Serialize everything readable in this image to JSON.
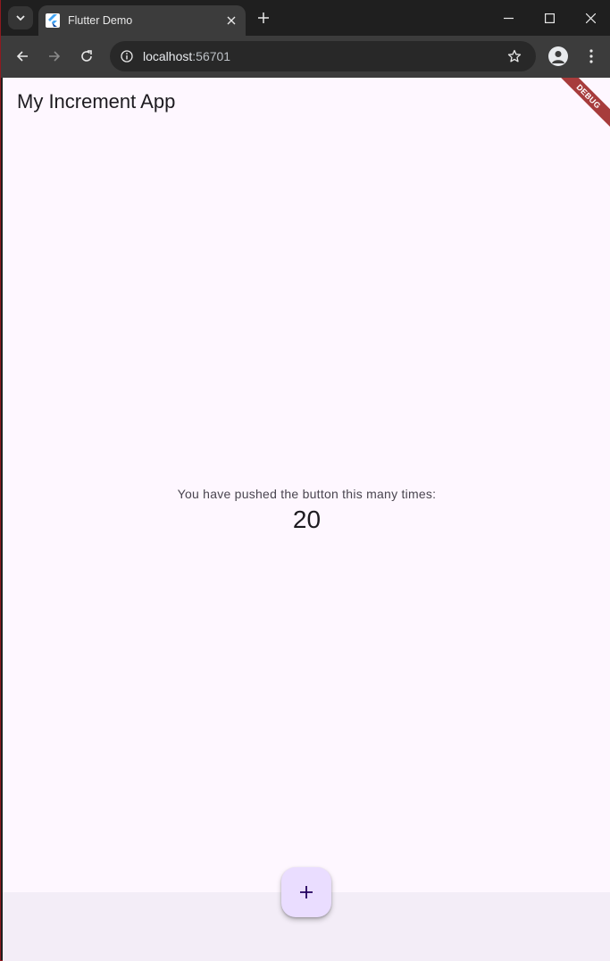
{
  "browser": {
    "tab_title": "Flutter Demo",
    "url_host": "localhost",
    "url_port": ":56701",
    "icons": {
      "tab_search": "chevron-down-icon",
      "favicon": "flutter-icon",
      "tab_close": "close-icon",
      "new_tab": "plus-icon",
      "minimize": "minimize-icon",
      "maximize": "maximize-icon",
      "close_window": "close-icon",
      "back": "arrow-left-icon",
      "forward": "arrow-right-icon",
      "reload": "reload-icon",
      "site_info": "info-icon",
      "bookmark": "star-icon",
      "profile": "person-icon",
      "menu": "kebab-menu-icon"
    }
  },
  "app": {
    "title": "My Increment App",
    "debug_banner": "DEBUG",
    "message": "You have pushed the button this many times:",
    "counter": "20",
    "fab_icon": "plus-icon",
    "colors": {
      "background": "#fef7ff",
      "bottom_area": "#f3edf7",
      "fab": "#eaddff",
      "debug_banner": "#a73c3c"
    }
  }
}
